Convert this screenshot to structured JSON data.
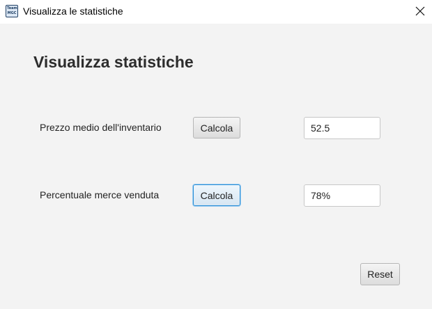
{
  "window": {
    "title": "Visualizza le statistiche",
    "icon_line1": "Team",
    "icon_line2": "MGC",
    "close_icon": "close-icon"
  },
  "main": {
    "heading": "Visualizza statistiche",
    "rows": [
      {
        "label": "Prezzo medio dell'inventario",
        "button_label": "Calcola",
        "value": "52.5"
      },
      {
        "label": "Percentuale merce venduta",
        "button_label": "Calcola",
        "value": "78%"
      }
    ],
    "reset_label": "Reset"
  },
  "colors": {
    "focus_border": "#2b8fd6",
    "background": "#f3f3f3"
  }
}
